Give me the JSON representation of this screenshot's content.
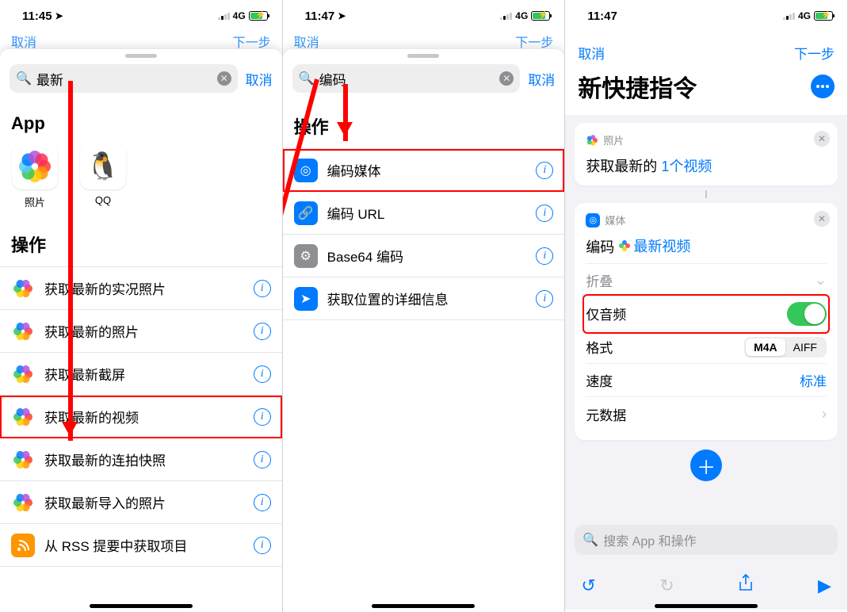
{
  "status": {
    "time1": "11:45",
    "time2": "11:47",
    "time3": "11:47",
    "net": "4G"
  },
  "peek": {
    "cancel": "取消",
    "next_trunc": "下一步"
  },
  "search": {
    "value1": "最新",
    "value2": "编码",
    "cancel": "取消"
  },
  "pane1": {
    "apps_header": "App",
    "app_photos": "照片",
    "app_qq": "QQ",
    "actions_header": "操作",
    "rows": [
      "获取最新的实况照片",
      "获取最新的照片",
      "获取最新截屏",
      "获取最新的视频",
      "获取最新的连拍快照",
      "获取最新导入的照片",
      "从 RSS 提要中获取项目"
    ]
  },
  "pane2": {
    "actions_header": "操作",
    "rows": [
      "编码媒体",
      "编码 URL",
      "Base64 编码",
      "获取位置的详细信息"
    ]
  },
  "pane3": {
    "nav_cancel": "取消",
    "nav_next": "下一步",
    "title": "新快捷指令",
    "card1_kind": "照片",
    "card1_prefix": "获取最新的",
    "card1_param": "1个视频",
    "card2_kind": "媒体",
    "card2_prefix": "编码",
    "card2_param": "最新视频",
    "collapse": "折叠",
    "opt_audio": "仅音频",
    "opt_format": "格式",
    "fmt_m4a": "M4A",
    "fmt_aiff": "AIFF",
    "opt_speed": "速度",
    "speed_val": "标准",
    "opt_meta": "元数据",
    "search_placeholder": "搜索 App 和操作"
  }
}
